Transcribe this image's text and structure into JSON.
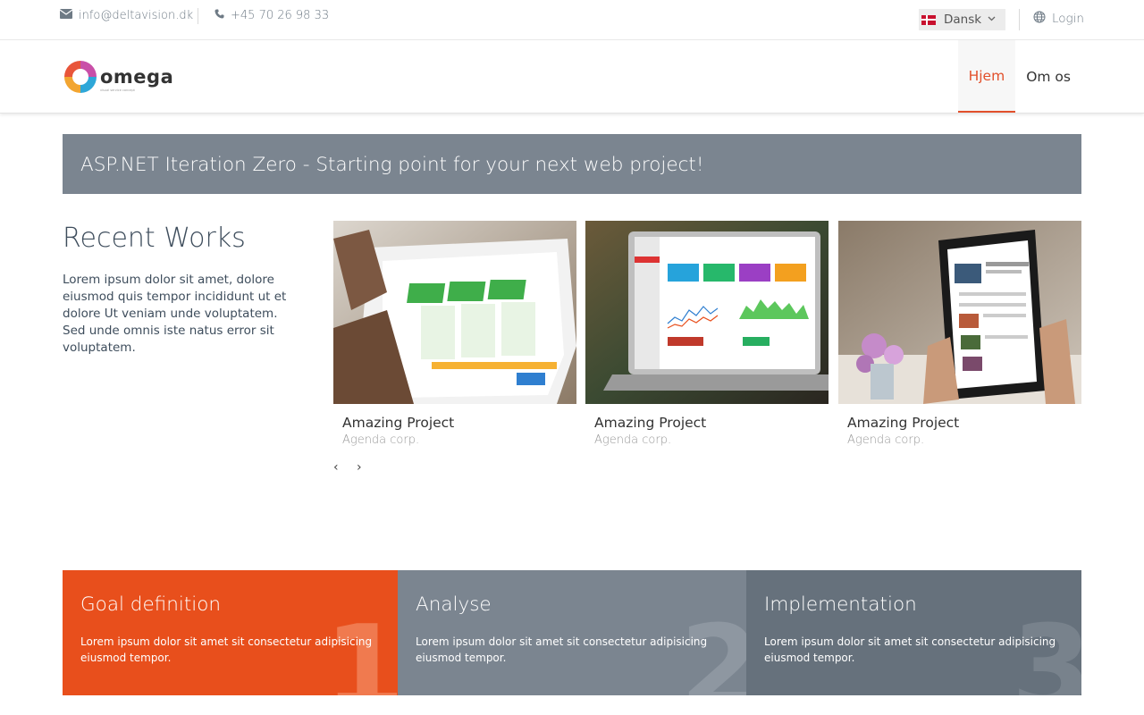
{
  "topbar": {
    "email": "info@deltavision.dk",
    "phone": "+45 70 26 98 33",
    "language": "Dansk",
    "login": "Login"
  },
  "logo": {
    "text": "omega",
    "tagline": "visual service concept"
  },
  "nav": {
    "items": [
      {
        "label": "Hjem",
        "active": true
      },
      {
        "label": "Om os",
        "active": false
      }
    ]
  },
  "banner": {
    "text": "ASP.NET Iteration Zero - Starting point for your next web project!"
  },
  "recent_works": {
    "title": "Recent Works",
    "text": "Lorem ipsum dolor sit amet, dolore eiusmod quis tempor incididunt ut et dolore Ut veniam unde voluptatem. Sed unde omnis iste natus error sit voluptatem.",
    "projects": [
      {
        "title": "Amazing Project",
        "subtitle": "Agenda corp."
      },
      {
        "title": "Amazing Project",
        "subtitle": "Agenda corp."
      },
      {
        "title": "Amazing Project",
        "subtitle": "Agenda corp."
      }
    ],
    "prev": "‹",
    "next": "›"
  },
  "steps": [
    {
      "title": "Goal definition",
      "text": "Lorem ipsum dolor sit amet sit consectetur adipisicing eiusmod tempor.",
      "number": "1"
    },
    {
      "title": "Analyse",
      "text": "Lorem ipsum dolor sit amet sit consectetur adipisicing eiusmod tempor.",
      "number": "2"
    },
    {
      "title": "Implementation",
      "text": "Lorem ipsum dolor sit amet sit consectetur adipisicing eiusmod tempor.",
      "number": "3"
    }
  ],
  "colors": {
    "accent": "#e84f1c",
    "banner": "#7b8590",
    "step3": "#66717c"
  }
}
